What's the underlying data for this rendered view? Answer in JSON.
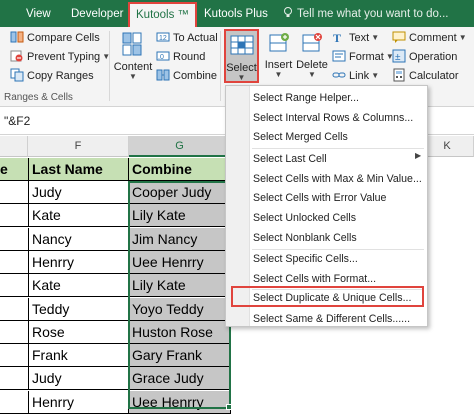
{
  "tabs": {
    "view": "View",
    "developer": "Developer",
    "kutools": "Kutools ™",
    "kutools_plus": "Kutools Plus",
    "tell_me": "Tell me what you want to do..."
  },
  "ribbon": {
    "compare_cells": "Compare Cells",
    "prevent_typing": "Prevent Typing",
    "copy_ranges": "Copy Ranges",
    "content": "Content",
    "to_actual": "To Actual",
    "round": "Round",
    "combine": "Combine",
    "select": "Select",
    "insert": "Insert",
    "delete": "Delete",
    "text": "Text",
    "format": "Format",
    "link": "Link",
    "comment": "Comment",
    "operation": "Operation",
    "calculator": "Calculator",
    "group_label": "Ranges & Cells"
  },
  "formula": {
    "text": "\"&F2"
  },
  "columns": {
    "e_text": "e",
    "f": "F",
    "g": "G",
    "k": "K"
  },
  "table": {
    "header_e": "e",
    "header_last_name": "Last Name",
    "header_combine": "Combine",
    "rows": [
      {
        "last": "Judy",
        "combine": "Cooper Judy"
      },
      {
        "last": "Kate",
        "combine": "Lily Kate"
      },
      {
        "last": "Nancy",
        "combine": "Jim Nancy"
      },
      {
        "last": "Henrry",
        "combine": "Uee Henrry"
      },
      {
        "last": "Kate",
        "combine": "Lily Kate"
      },
      {
        "last": "Teddy",
        "combine": "Yoyo Teddy"
      },
      {
        "last": "Rose",
        "combine": "Huston Rose"
      },
      {
        "last": "Frank",
        "combine": "Gary Frank"
      },
      {
        "last": "Judy",
        "combine": "Grace Judy"
      },
      {
        "last": "Henrry",
        "combine": "Uee Henrry"
      }
    ]
  },
  "menu": {
    "items": [
      "Select Range Helper...",
      "Select Interval Rows & Columns...",
      "Select Merged Cells",
      "Select Last Cell",
      "Select Cells with Max & Min Value...",
      "Select Cells with Error Value",
      "Select Unlocked Cells",
      "Select Nonblank Cells",
      "Select Specific Cells...",
      "Select Cells with Format...",
      "Select Duplicate & Unique Cells...",
      "Select Same & Different Cells......"
    ]
  },
  "colors": {
    "excel_green": "#217346",
    "highlight_red": "#e0443d",
    "header_fill": "#c6e0b4",
    "selection_fill": "#c6c6c6"
  }
}
